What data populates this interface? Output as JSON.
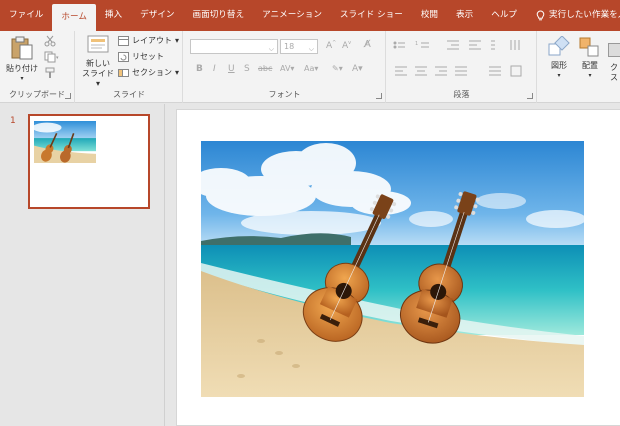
{
  "tabs": [
    {
      "label": "ファイル",
      "active": false
    },
    {
      "label": "ホーム",
      "active": true
    },
    {
      "label": "挿入",
      "active": false
    },
    {
      "label": "デザイン",
      "active": false
    },
    {
      "label": "画面切り替え",
      "active": false
    },
    {
      "label": "アニメーション",
      "active": false
    },
    {
      "label": "スライド ショー",
      "active": false
    },
    {
      "label": "校閲",
      "active": false
    },
    {
      "label": "表示",
      "active": false
    },
    {
      "label": "ヘルプ",
      "active": false
    }
  ],
  "tell_me": "実行したい作業を入力し",
  "ribbon": {
    "clipboard": {
      "label": "クリップボード",
      "paste": "貼り付け"
    },
    "slides": {
      "label": "スライド",
      "new_slide_line1": "新しい",
      "new_slide_line2": "スライド",
      "layout": "レイアウト",
      "reset": "リセット",
      "section": "セクション"
    },
    "font": {
      "label": "フォント",
      "size": "18"
    },
    "paragraph": {
      "label": "段落"
    },
    "drawing": {
      "shape": "図形",
      "arrange": "配置",
      "partial": "ク",
      "partial2": "ス"
    }
  },
  "slide_panel": {
    "number": "1"
  },
  "colors": {
    "accent": "#b7472a",
    "ribbon_bg": "#f3f3f3",
    "workspace": "#e6e6e6"
  },
  "icons": [
    "lightbulb-icon",
    "paste-icon",
    "cut-icon",
    "copy-icon",
    "format-painter-icon",
    "new-slide-icon",
    "layout-icon",
    "reset-icon",
    "section-icon",
    "bold-icon",
    "italic-icon",
    "underline-icon",
    "strikethrough-icon",
    "bullets-icon",
    "numbering-icon",
    "shapes-icon",
    "arrange-icon",
    "guitar-icon"
  ]
}
